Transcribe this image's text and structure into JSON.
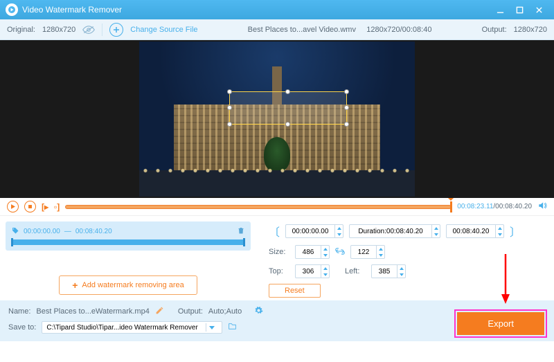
{
  "app": {
    "title": "Video Watermark Remover"
  },
  "toolbar": {
    "original_label": "Original:",
    "original_res": "1280x720",
    "change_source": "Change Source File",
    "filename": "Best Places to...avel Video.wmv",
    "file_res": "1280x720",
    "file_dur": "00:08:40",
    "output_label": "Output:",
    "output_res": "1280x720"
  },
  "player": {
    "current": "00:08:23.11",
    "duration": "00:08:40.20"
  },
  "clip": {
    "start": "00:00:00.00",
    "sep": "—",
    "end": "00:08:40.20"
  },
  "add_area": "Add watermark removing area",
  "params": {
    "t_start": "00:00:00.00",
    "dur_label": "Duration:",
    "dur_val": "00:08:40.20",
    "t_end": "00:08:40.20",
    "size_label": "Size:",
    "w": "486",
    "h": "122",
    "top_label": "Top:",
    "top": "306",
    "left_label": "Left:",
    "left": "385",
    "reset": "Reset"
  },
  "bottom": {
    "name_label": "Name:",
    "name_val": "Best Places to...eWatermark.mp4",
    "output_label": "Output:",
    "output_val": "Auto;Auto",
    "save_label": "Save to:",
    "save_path": "C:\\Tipard Studio\\Tipar...ideo Watermark Remover"
  },
  "export": "Export"
}
